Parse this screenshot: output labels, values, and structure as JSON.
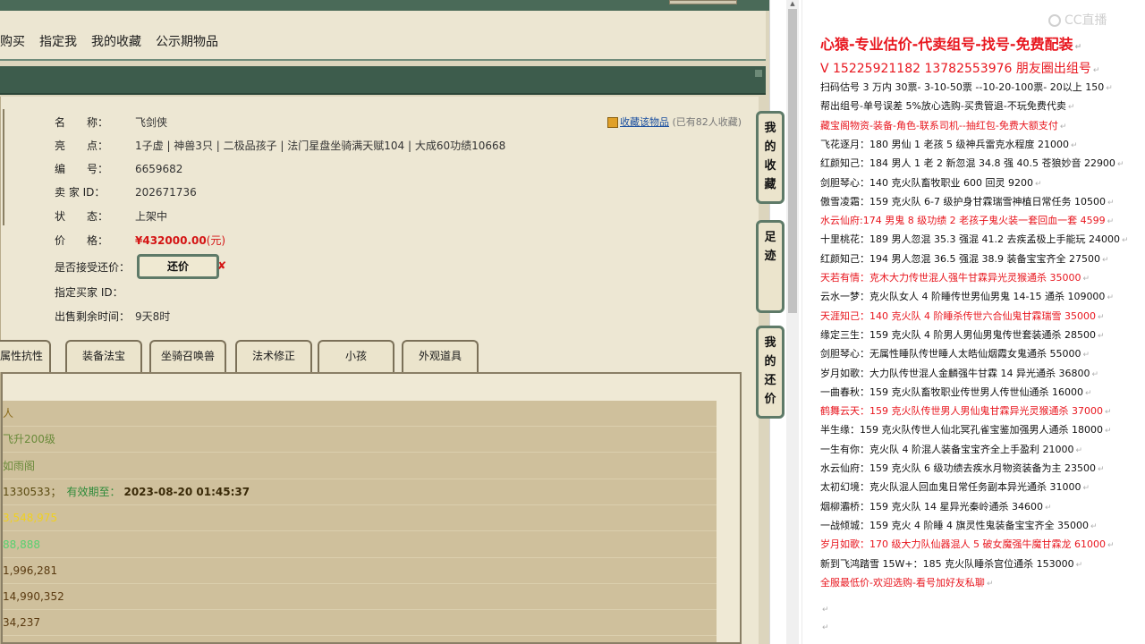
{
  "nav": {
    "tabs": [
      "购买",
      "指定我",
      "我的收藏",
      "公示期物品"
    ]
  },
  "item": {
    "fields": [
      {
        "label": "名　　称：",
        "value": "飞剑侠"
      },
      {
        "label": "亮　　点：",
        "value": "1子虚 | 神兽3只 | 二极品孩子 | 法门星盘坐骑满天赋104 | 大成60功绩10668"
      },
      {
        "label": "编　　号：",
        "value": "6659682"
      },
      {
        "label": "卖 家 ID：",
        "value": "202671736"
      },
      {
        "label": "状　　态：",
        "value": "上架中"
      },
      {
        "label": "价　　格：",
        "value": ""
      },
      {
        "label": "是否接受还价：",
        "value": ""
      },
      {
        "label": "指定买家 ID：",
        "value": ""
      },
      {
        "label": "出售剩余时间：",
        "value": "9天8时"
      }
    ],
    "price": "¥432000.00",
    "price_unit": "(元)",
    "offer_button": "还价",
    "offer_mark": "✘",
    "fav_link": "收藏该物品",
    "fav_count": "(已有82人收藏)"
  },
  "tabs": [
    "属性抗性",
    "装备法宝",
    "坐骑召唤兽",
    "法术修正",
    "小孩",
    "外观道具"
  ],
  "details": [
    {
      "text": "人",
      "color": "#8a6a1a"
    },
    {
      "text": "飞升200级",
      "color": "#6a8a3a"
    },
    {
      "text": "如雨阁",
      "color": "#6a8a3a"
    },
    {
      "text": "1330533；",
      "extra_label": "有效期至：",
      "extra_value": "2023-08-20 01:45:37",
      "color": "#5a4a10"
    },
    {
      "text": "3,548,975",
      "color": "#f0d020"
    },
    {
      "text": "88,888",
      "color": "#58d070"
    },
    {
      "text": "1,996,281",
      "color": "#5a3a10"
    },
    {
      "text": "14,990,352",
      "color": "#5a3a10"
    },
    {
      "text": "34,237",
      "color": "#5a3a10"
    }
  ],
  "side_buttons": [
    {
      "name": "favorites",
      "label": "我的收藏"
    },
    {
      "name": "footprint",
      "label": "足迹"
    },
    {
      "name": "my-offers",
      "label": "我的还价"
    }
  ],
  "watermark": "CC直播",
  "doc": {
    "title": "心猿-专业估价-代卖组号-找号-免费配装",
    "contact": "V 15225921182   13782553976 朋友圈出组号",
    "lines": [
      {
        "text": "扫码估号 3 万内 30票- 3-10-50票  --10-20-100票- 20以上 150",
        "red": false
      },
      {
        "text": "帮出组号-单号误差 5%放心选购-买贵管退-不玩免费代卖",
        "red": false
      },
      {
        "text": "藏宝阁物资-装备-角色-联系司机--抽红包-免费大额支付",
        "red": true
      },
      {
        "text": "飞花逐月：180 男仙 1 老孩 5 级神兵雷克水程度 21000",
        "red": false
      },
      {
        "text": "红颜知己：184 男人 1 老 2 新忽混 34.8 强 40.5 苍狼妙音 22900",
        "red": false
      },
      {
        "text": "剑胆琴心：140 克火队畜牧职业 600 回灵 9200",
        "red": false
      },
      {
        "text": "傲雪凌霜：159 克火队 6-7 级护身甘霖瑞雪神植日常任务 10500",
        "red": false
      },
      {
        "text": "水云仙府:174 男鬼 8 级功绩 2 老孩子鬼火装一套回血一套 4599",
        "red": true
      },
      {
        "text": "十里桃花：189 男人忽混 35.3 强混 41.2 去疾孟极上手能玩 24000",
        "red": false
      },
      {
        "text": "红颜知己：194 男人忽混 36.5 强混 38.9 装备宝宝齐全 27500",
        "red": false
      },
      {
        "text": "天若有情：克木大力传世混人强牛甘霖异光灵猴通杀 35000",
        "red": true
      },
      {
        "text": "云水一梦：克火队女人 4 阶睡传世男仙男鬼 14-15 通杀 109000",
        "red": false
      },
      {
        "text": "天涯知己：140 克火队 4 阶睡杀传世六合仙鬼甘霖瑞雪 35000",
        "red": true
      },
      {
        "text": "缘定三生：159 克火队 4 阶男人男仙男鬼传世套装通杀 28500",
        "red": false
      },
      {
        "text": "剑胆琴心：无属性睡队传世睡人太皓仙烟霞女鬼通杀 55000",
        "red": false
      },
      {
        "text": "岁月如歌：大力队传世混人金麟强牛甘霖 14 异光通杀 36800",
        "red": false
      },
      {
        "text": "一曲春秋：159 克火队畜牧职业传世男人传世仙通杀 16000",
        "red": false
      },
      {
        "text": "鹤舞云天：159 克火队传世男人男仙鬼甘霖异光灵猴通杀 37000",
        "red": true
      },
      {
        "text": "半生缘：159 克火队传世人仙北冥孔雀宝鉴加强男人通杀 18000",
        "red": false
      },
      {
        "text": "一生有你：克火队 4 阶混人装备宝宝齐全上手盈利 21000",
        "red": false
      },
      {
        "text": "水云仙府：159 克火队 6 级功绩去疾水月物资装备为主 23500",
        "red": false
      },
      {
        "text": "太初幻境：克火队混人回血鬼日常任务副本异光通杀 31000",
        "red": false
      },
      {
        "text": "烟柳灞桥：159 克火队 14 星异光秦岭通杀 34600",
        "red": false
      },
      {
        "text": "一战倾城：159 克火 4 阶睡 4 旗灵性鬼装备宝宝齐全 35000",
        "red": false
      },
      {
        "text": "岁月如歌：170 级大力队仙器混人 5 破女魔强牛魔甘霖龙 61000",
        "red": true
      },
      {
        "text": "新到飞鸿踏雪 15W+：185 克火队睡杀宫位通杀 153000",
        "red": false
      },
      {
        "text": "全服最低价-欢迎选购-看号加好友私聊",
        "red": true
      }
    ]
  }
}
